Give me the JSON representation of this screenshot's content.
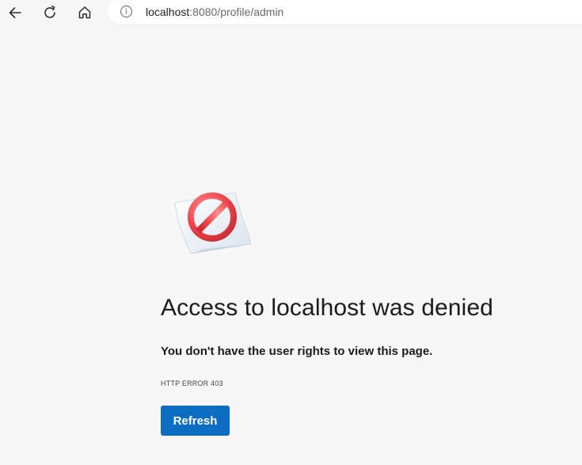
{
  "browser": {
    "address_bar": {
      "url_host": "localhost",
      "url_rest": ":8080/profile/admin",
      "info_glyph": "i"
    },
    "icons": {
      "back": "back-arrow-icon",
      "reload": "reload-icon",
      "home": "home-icon",
      "site_info": "info-icon"
    }
  },
  "error_page": {
    "illustration": "blocked-sign-icon",
    "headline": "Access to localhost was denied",
    "message": "You don't have the user rights to view this page.",
    "error_code": "HTTP ERROR 403",
    "refresh_label": "Refresh"
  },
  "colors": {
    "page_background": "#f7f7f7",
    "button_blue": "#0b6cc1",
    "blocked_red": "#f0474d"
  }
}
